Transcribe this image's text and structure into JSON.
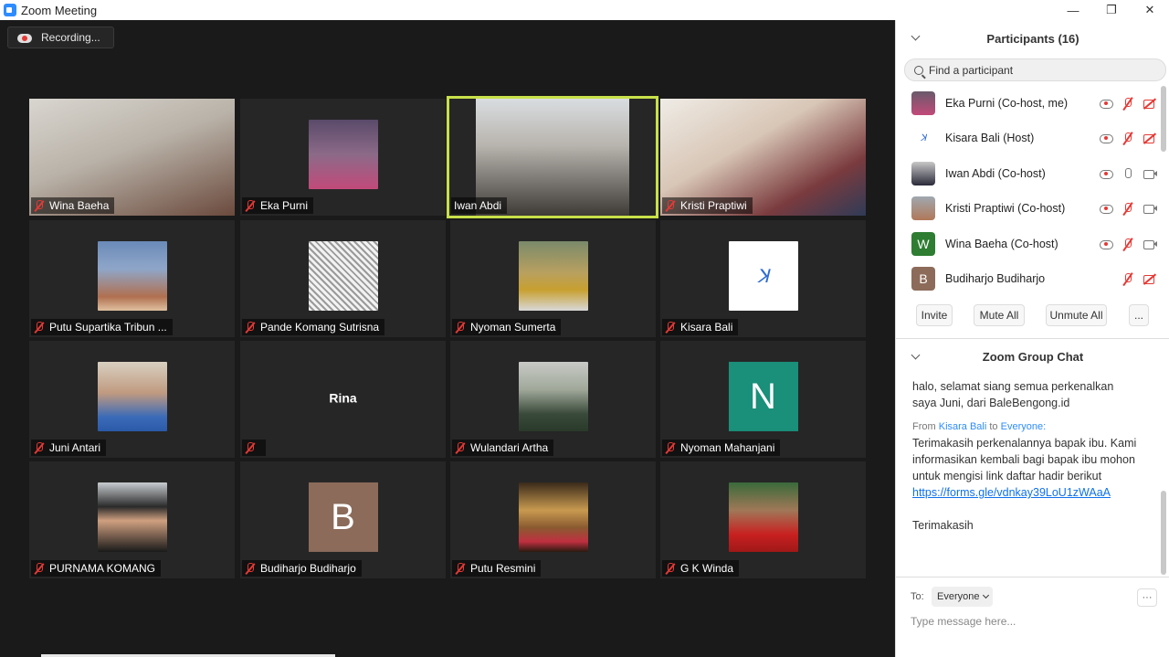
{
  "window": {
    "title": "Zoom Meeting",
    "min": "—",
    "restore": "❐",
    "close": "✕"
  },
  "recording": {
    "label": "Recording..."
  },
  "tiles": [
    {
      "name": "Wina Baeha"
    },
    {
      "name": "Eka Purni"
    },
    {
      "name": "Iwan Abdi"
    },
    {
      "name": "Kristi Praptiwi"
    },
    {
      "name": "Putu Supartika Tribun ..."
    },
    {
      "name": "Pande Komang Sutrisna"
    },
    {
      "name": "Nyoman Sumerta"
    },
    {
      "name": "Kisara Bali"
    },
    {
      "name": "Juni Antari"
    },
    {
      "name": "Rina"
    },
    {
      "name": "Wulandari Artha"
    },
    {
      "name": "Nyoman Mahanjani",
      "letter": "N"
    },
    {
      "name": "PURNAMA KOMANG"
    },
    {
      "name": "Budiharjo Budiharjo",
      "letter": "B"
    },
    {
      "name": "Putu Resmini"
    },
    {
      "name": "G K Winda"
    }
  ],
  "participants_panel": {
    "title": "Participants (16)",
    "search_placeholder": "Find a participant",
    "list": [
      {
        "name": "Eka Purni (Co-host, me)"
      },
      {
        "name": "Kisara Bali (Host)"
      },
      {
        "name": "Iwan Abdi (Co-host)"
      },
      {
        "name": "Kristi Praptiwi (Co-host)"
      },
      {
        "name": "Wina Baeha (Co-host)",
        "letter": "W"
      },
      {
        "name": "Budiharjo Budiharjo",
        "letter": "B"
      }
    ],
    "buttons": {
      "invite": "Invite",
      "mute_all": "Mute All",
      "unmute_all": "Unmute All",
      "more": "..."
    }
  },
  "chat": {
    "title": "Zoom Group Chat",
    "message1": "halo, selamat siang semua perkenalkan saya Juni, dari BaleBengong.id",
    "from_label": "From",
    "from_name": "Kisara Bali",
    "to_word": "to",
    "to_name": "Everyone:",
    "message2": "Terimakasih perkenalannya bapak ibu. Kami informasikan kembali bagi bapak ibu mohon untuk mengisi link daftar hadir berikut",
    "link": "https://forms.gle/vdnkay39LoU1zWAaA",
    "message3": "Terimakasih",
    "to_label": "To:",
    "to_value": "Everyone",
    "more": "···",
    "input_placeholder": "Type message here..."
  },
  "colors": {
    "speaking_border": "#c8e04a",
    "muted_red": "#e53935",
    "link_blue": "#0e71eb"
  }
}
